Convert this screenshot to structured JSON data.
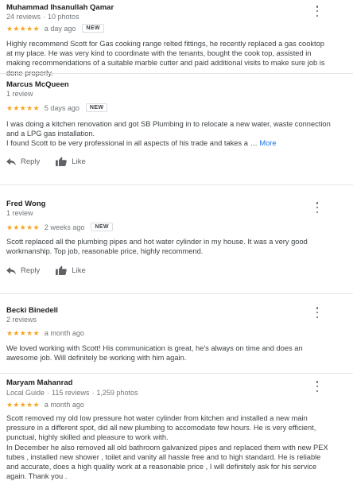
{
  "reviews": [
    {
      "name": "Muhammad Ihsanullah Qamar",
      "reviews_count": "24 reviews",
      "photos_count": "10 photos",
      "stars": "★★★★★",
      "rating": 5,
      "time": "a day ago",
      "badge": "NEW",
      "text": "Highly recommend Scott for Gas cooking range relted fittings, he recently replaced a gas cooktop at my place. He was very kind to coordinate with the tenants, bought the cook top, assisted in making recommendations of a suitable marble cutter and paid additional visits to make sure job is done properly."
    },
    {
      "name": "Marcus McQueen",
      "reviews_count": "1 review",
      "stars": "★★★★★",
      "rating": 5,
      "time": "5 days ago",
      "badge": "NEW",
      "text_1": "I was doing a kitchen renovation and got SB Plumbing in to relocate a new water, waste connection and a LPG gas installation.",
      "text_2": "I found Scott to be very professional in all aspects of his trade and takes a …",
      "more_label": "More",
      "reply_label": "Reply",
      "like_label": "Like"
    },
    {
      "name": "Fred Wong",
      "reviews_count": "1 review",
      "stars": "★★★★★",
      "rating": 5,
      "time": "2 weeks ago",
      "badge": "NEW",
      "text": "Scott replaced all the plumbing pipes and hot water cylinder in my house. It was a very good workmanship. Top job, reasonable price, highly recommend.",
      "reply_label": "Reply",
      "like_label": "Like"
    },
    {
      "name": "Becki Binedell",
      "reviews_count": "2 reviews",
      "stars": "★★★★★",
      "rating": 5,
      "time": "a month ago",
      "text": "We loved working with Scott! His communication is great, he's always on time and does an awesome job.  Will definitely be working with him again."
    },
    {
      "name": "Maryam Mahanrad",
      "local_guide": "Local Guide",
      "reviews_count": "115 reviews",
      "photos_count": "1,259 photos",
      "stars": "★★★★★",
      "rating": 5,
      "time": "a month ago",
      "text_1": "Scott removed my old low pressure hot water cylinder from kitchen and installed a new main pressure in a different spot, did all new plumbing to accomodate few hours. He is very efficient, punctual, highly skilled and pleasure to work with.",
      "text_2": "In December he also removed all old bathroom galvanized pipes and replaced them with new PEX tubes , installed new shower , toilet and vanity all hassle free and to high standard. He is reliable and accurate, does a high quality work at a reasonable price , I will definitely  ask for his service again. Thank you ."
    }
  ],
  "colors": {
    "star": "#f5a623",
    "link": "#1a73e8",
    "muted": "#70757a"
  },
  "icons": {
    "more": "more-vert-icon",
    "reply": "reply-arrow-icon",
    "like": "thumbs-up-icon"
  }
}
